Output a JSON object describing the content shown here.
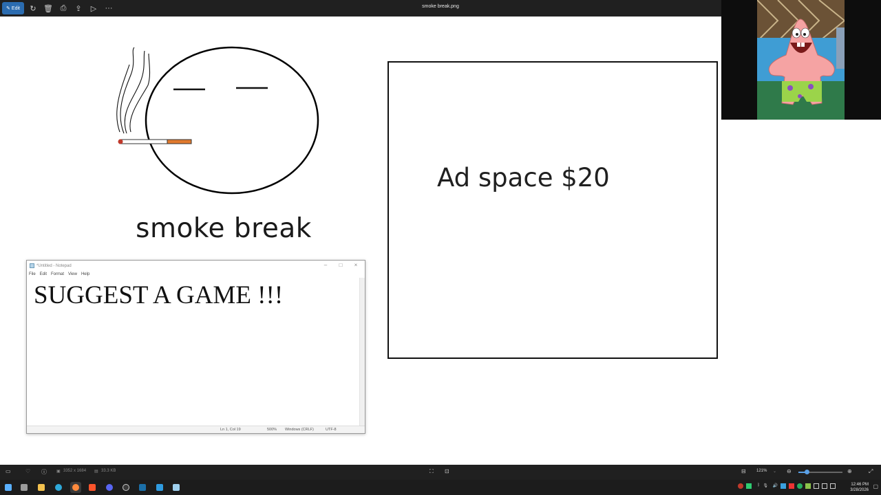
{
  "app": {
    "title": "smoke break.png",
    "edit_label": "Edit",
    "toolbar_icons": [
      "rotate-icon",
      "delete-icon",
      "print-icon",
      "share-icon",
      "slideshow-icon",
      "more-icon"
    ],
    "more_glyph": "···"
  },
  "image": {
    "caption": "smoke break",
    "ad_text": "Ad space $20"
  },
  "notepad": {
    "title": "*Untitled - Notepad",
    "menu": [
      "File",
      "Edit",
      "Format",
      "View",
      "Help"
    ],
    "content": "SUGGEST A GAME !!!",
    "status": {
      "position": "Ln 1, Col 19",
      "zoom": "500%",
      "line_ending": "Windows (CRLF)",
      "encoding": "UTF-8"
    }
  },
  "statusbar": {
    "dimensions": "3352 x 1684",
    "file_size": "33.3 KB",
    "zoom_label": "121%",
    "zoom_fraction": 0.2
  },
  "taskbar": {
    "apps": [
      "start-icon",
      "task-view-icon",
      "file-explorer-icon",
      "edge-icon",
      "firefox-icon",
      "brave-icon",
      "discord-icon",
      "obs-icon",
      "steam-icon",
      "vscode-icon",
      "notepad-icon"
    ],
    "time": "12:46 PM",
    "date": "3/28/2026"
  },
  "colors": {
    "toolbar_bg": "#202020",
    "accent": "#2b6cb0",
    "cigarette_filter": "#e07a2e",
    "webcam_bg": "#0d0d0d"
  }
}
